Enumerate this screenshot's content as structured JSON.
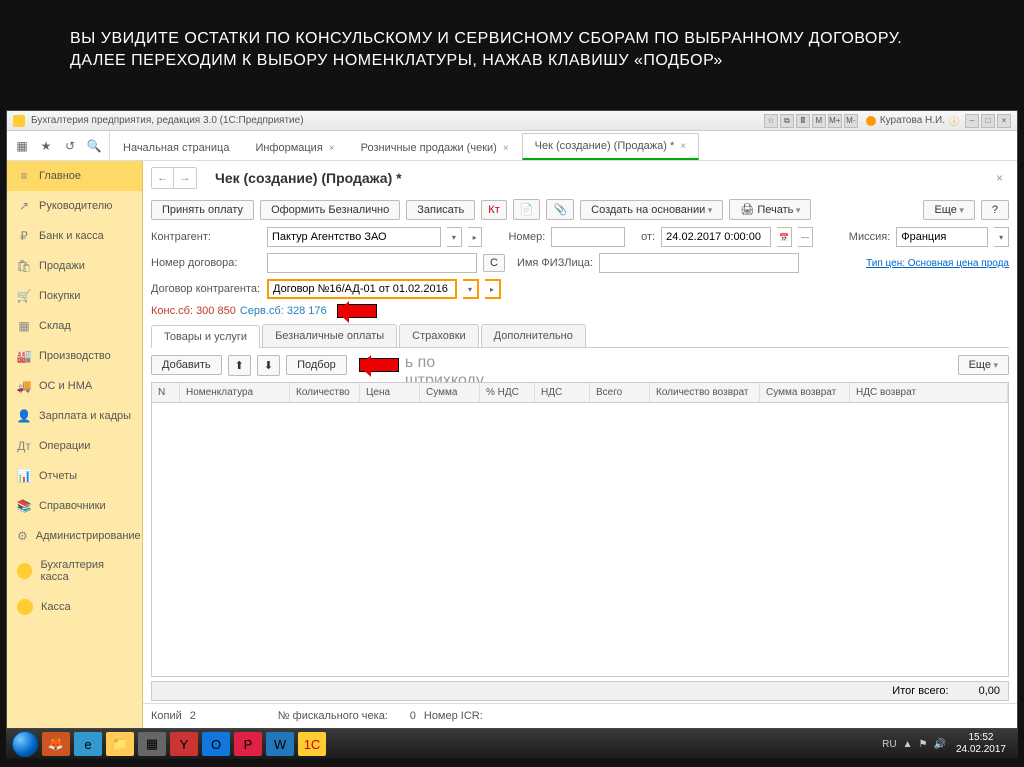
{
  "slide_title": "ВЫ УВИДИТЕ ОСТАТКИ ПО КОНСУЛЬСКОМУ И СЕРВИСНОМУ СБОРАМ ПО ВЫБРАННОМУ ДОГОВОРУ. ДАЛЕЕ ПЕРЕХОДИМ К ВЫБОРУ НОМЕНКЛАТУРЫ, НАЖАВ КЛАВИШУ «ПОДБОР»",
  "window_title": "Бухгалтерия предприятия, редакция 3.0  (1С:Предприятие)",
  "user_name": "Куратова Н.И.",
  "tabs": [
    {
      "label": "Начальная страница"
    },
    {
      "label": "Информация"
    },
    {
      "label": "Розничные продажи (чеки)"
    },
    {
      "label": "Чек (создание) (Продажа) *",
      "active": true
    }
  ],
  "sidebar": {
    "items": [
      {
        "label": "Главное",
        "icon": "≡"
      },
      {
        "label": "Руководителю",
        "icon": "↗"
      },
      {
        "label": "Банк и касса",
        "icon": "₽"
      },
      {
        "label": "Продажи",
        "icon": "🛍"
      },
      {
        "label": "Покупки",
        "icon": "🛒"
      },
      {
        "label": "Склад",
        "icon": "▦"
      },
      {
        "label": "Производство",
        "icon": "🏭"
      },
      {
        "label": "ОС и НМА",
        "icon": "🚚"
      },
      {
        "label": "Зарплата и кадры",
        "icon": "👤"
      },
      {
        "label": "Операции",
        "icon": "Дт"
      },
      {
        "label": "Отчеты",
        "icon": "📊"
      },
      {
        "label": "Справочники",
        "icon": "📚"
      },
      {
        "label": "Администрирование",
        "icon": "⚙"
      },
      {
        "label": "Бухгалтерия касса",
        "yellow": true
      },
      {
        "label": "Касса",
        "yellow": true
      }
    ]
  },
  "page_title": "Чек (создание) (Продажа) *",
  "toolbar": {
    "accept_payment": "Принять оплату",
    "cashless": "Оформить Безналично",
    "save": "Записать",
    "create_based": "Создать на основании",
    "print": "Печать",
    "more": "Еще",
    "help": "?"
  },
  "form": {
    "counterparty_label": "Контрагент:",
    "counterparty_value": "Пактур Агентство ЗАО",
    "number_label": "Номер:",
    "date_label": "от:",
    "date_value": "24.02.2017 0:00:00",
    "mission_label": "Миссия:",
    "mission_value": "Франция",
    "contract_num_label": "Номер договора:",
    "btn_c": "С",
    "fio_label": "Имя ФИЗЛица:",
    "price_type_link": "Тип цен: Основная цена прода",
    "contract_label": "Договор контрагента:",
    "contract_value": "Договор №16/АД-01 от 01.02.2016"
  },
  "balances": {
    "kons": "Конс.сб: 300 850",
    "serv": "Серв.сб: 328 176"
  },
  "subtabs": [
    {
      "label": "Товары и услуги",
      "active": true
    },
    {
      "label": "Безналичные оплаты"
    },
    {
      "label": "Страховки"
    },
    {
      "label": "Дополнительно"
    }
  ],
  "row_toolbar": {
    "add": "Добавить",
    "up": "⬆",
    "down": "⬇",
    "selection": "Подбор",
    "barcode_placeholder": "ь по штрихкоду",
    "more": "Еще"
  },
  "table_columns": [
    "N",
    "Номенклатура",
    "Количество",
    "Цена",
    "Сумма",
    "% НДС",
    "НДС",
    "Всего",
    "Количество возврат",
    "Сумма возврат",
    "НДС возврат"
  ],
  "total": {
    "label": "Итог всего:",
    "value": "0,00"
  },
  "footer": {
    "copies_label": "Копий",
    "copies_value": "2",
    "fiscal_label": "№ фискального чека:",
    "fiscal_value": "0",
    "icr_label": "Номер ICR:"
  },
  "taskbar": {
    "lang": "RU",
    "time": "15:52",
    "date": "24.02.2017"
  }
}
